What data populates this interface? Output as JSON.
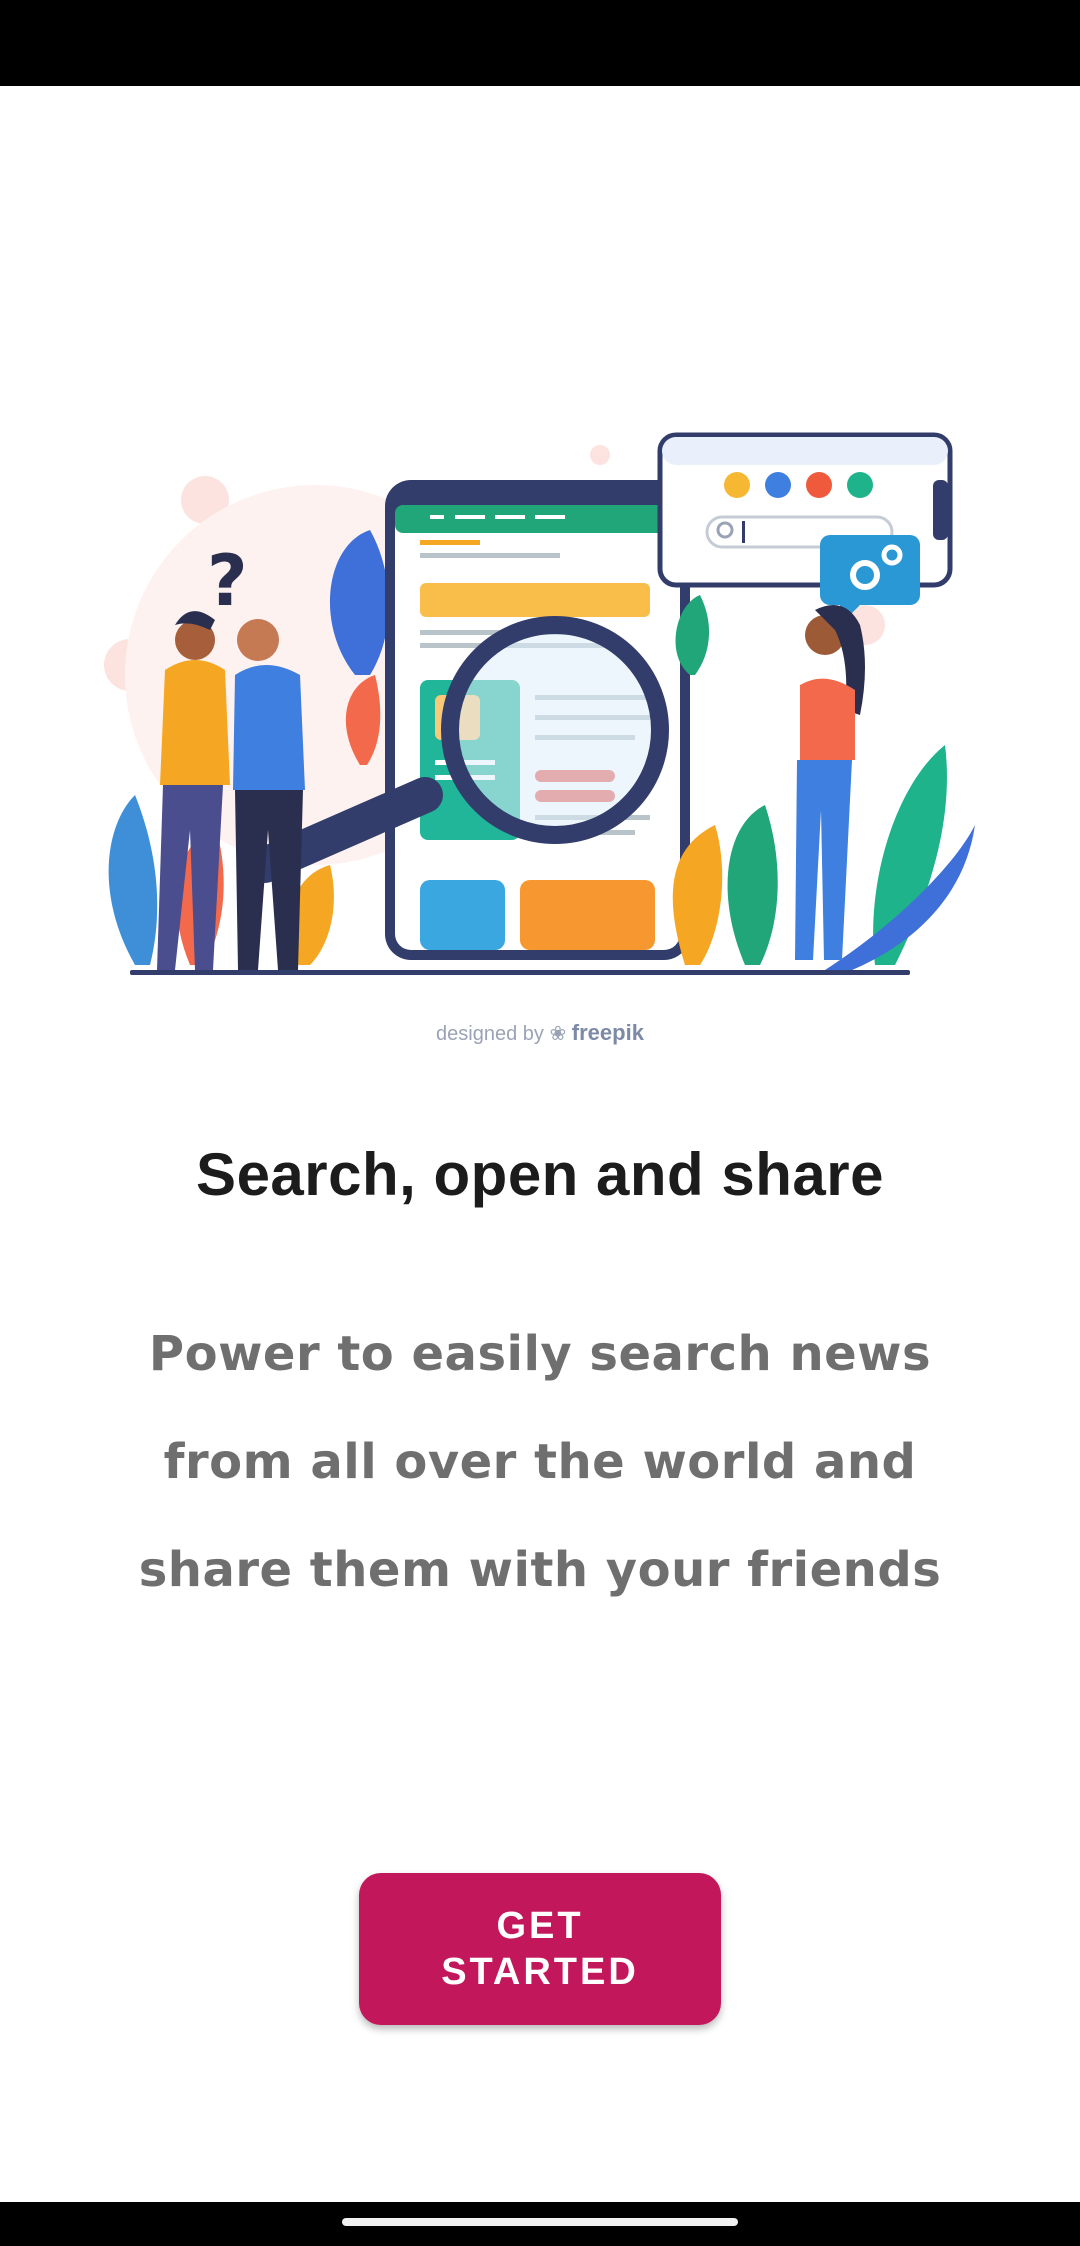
{
  "illustration": {
    "credit_prefix": "designed by",
    "credit_brand": "freepik"
  },
  "content": {
    "title": "Search, open and share",
    "subtitle": "Power to easily search news from all over the world and share them with your friends"
  },
  "actions": {
    "get_started_label": "GET STARTED"
  },
  "colors": {
    "accent": "#c2185b",
    "title": "#1c1c1c",
    "subtitle": "#6f6f6f"
  }
}
